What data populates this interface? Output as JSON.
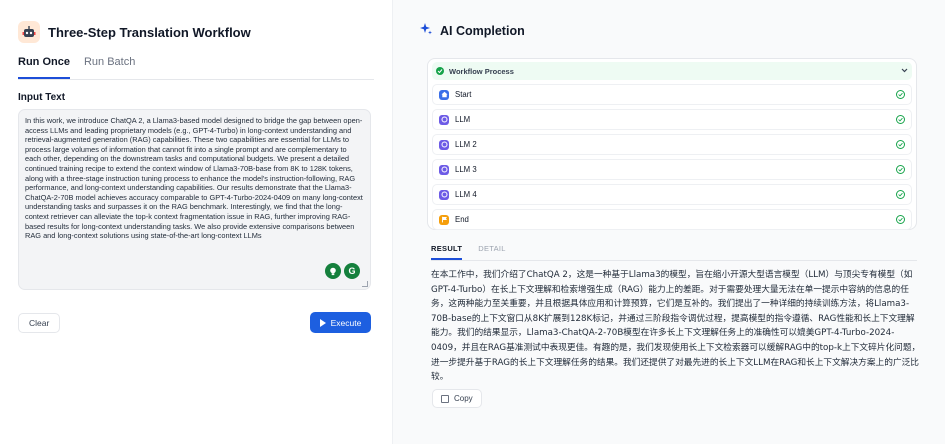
{
  "app": {
    "title": "Three-Step Translation Workflow",
    "icon": "robot-icon"
  },
  "tabs": [
    {
      "label": "Run Once",
      "active": true
    },
    {
      "label": "Run Batch",
      "active": false
    }
  ],
  "input": {
    "label": "Input Text",
    "value": "In this work, we introduce ChatQA 2, a Llama3-based model designed to bridge the gap between open-access LLMs and leading proprietary models (e.g., GPT-4-Turbo) in long-context understanding and retrieval-augmented generation (RAG) capabilities. These two capabilities are essential for LLMs to process large volumes of information that cannot fit into a single prompt and are complementary to each other, depending on the downstream tasks and computational budgets. We present a detailed continued training recipe to extend the context window of Llama3-70B-base from 8K to 128K tokens, along with a three-stage instruction tuning process to enhance the model's instruction-following, RAG performance, and long-context understanding capabilities. Our results demonstrate that the Llama3-ChatQA-2-70B model achieves accuracy comparable to GPT-4-Turbo-2024-0409 on many long-context understanding tasks and surpasses it on the RAG benchmark. Interestingly, we find that the long-context retriever can alleviate the top-k context fragmentation issue in RAG, further improving RAG-based results for long-context understanding tasks. We also provide extensive comparisons between RAG and long-context solutions using state-of-the-art long-context LLMs"
  },
  "buttons": {
    "clear": "Clear",
    "execute": "Execute",
    "copy": "Copy"
  },
  "completion": {
    "title": "AI Completion",
    "workflow": {
      "title": "Workflow Process",
      "nodes": [
        {
          "label": "Start",
          "icon": "home-icon",
          "color": "#3b6fe8"
        },
        {
          "label": "LLM",
          "icon": "llm-icon",
          "color": "#6d5be6"
        },
        {
          "label": "LLM 2",
          "icon": "llm-icon",
          "color": "#6d5be6"
        },
        {
          "label": "LLM 3",
          "icon": "llm-icon",
          "color": "#6d5be6"
        },
        {
          "label": "LLM 4",
          "icon": "llm-icon",
          "color": "#6d5be6"
        },
        {
          "label": "End",
          "icon": "flag-icon",
          "color": "#f59e0b"
        }
      ]
    },
    "tabs": [
      {
        "label": "RESULT",
        "active": true
      },
      {
        "label": "DETAIL",
        "active": false
      }
    ],
    "result": "在本工作中，我们介绍了ChatQA 2，这是一种基于Llama3的模型，旨在缩小开源大型语言模型（LLM）与顶尖专有模型（如GPT-4-Turbo）在长上下文理解和检索增强生成（RAG）能力上的差距。对于需要处理大量无法在单一提示中容纳的信息的任务，这两种能力至关重要，并且根据具体应用和计算预算，它们是互补的。我们提出了一种详细的持续训练方法，将Llama3-70B-base的上下文窗口从8K扩展到128K标记，并通过三阶段指令调优过程，提高模型的指令遵循、RAG性能和长上下文理解能力。我们的结果显示，Llama3-ChatQA-2-70B模型在许多长上下文理解任务上的准确性可以媲美GPT-4-Turbo-2024-0409，并且在RAG基准测试中表现更佳。有趣的是，我们发现使用长上下文检索器可以缓解RAG中的top-k上下文碎片化问题，进一步提升基于RAG的长上下文理解任务的结果。我们还提供了对最先进的长上下文LLM在RAG和长上下文解决方案上的广泛比较。"
  },
  "colors": {
    "accent": "#1d5fe0",
    "success": "#16a34a"
  }
}
